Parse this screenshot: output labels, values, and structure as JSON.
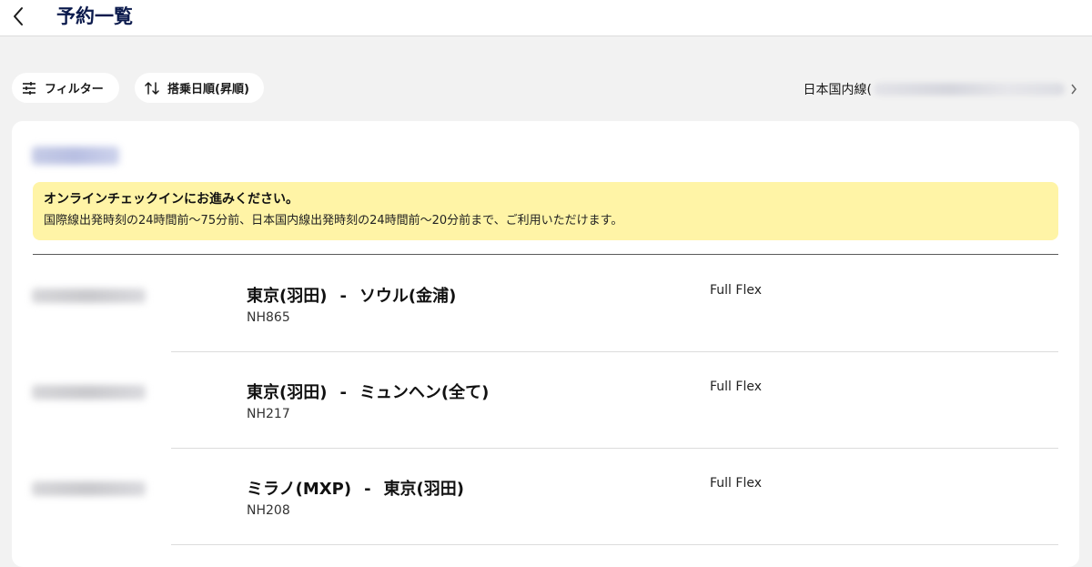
{
  "header": {
    "back_icon": "chevron-left-icon",
    "title": "予約一覧"
  },
  "toolbar": {
    "filter_label": "フィルター",
    "filter_icon": "sliders-icon",
    "sort_label": "搭乗日順(昇順)",
    "sort_icon": "sort-arrows-icon",
    "domestic_link_label": "日本国内線("
  },
  "notice": {
    "title": "オンラインチェックインにお進みください。",
    "body": "国際線出発時刻の24時間前〜75分前、日本国内線出発時刻の24時間前〜20分前まで、ご利用いただけます。"
  },
  "bookings": [
    {
      "origin": "東京(羽田)",
      "separator": "-",
      "destination": "ソウル(金浦)",
      "flight_no": "NH865",
      "fare": "Full Flex"
    },
    {
      "origin": "東京(羽田)",
      "separator": "-",
      "destination": "ミュンヘン(全て)",
      "flight_no": "NH217",
      "fare": "Full Flex"
    },
    {
      "origin": "ミラノ(MXP)",
      "separator": "-",
      "destination": "東京(羽田)",
      "flight_no": "NH208",
      "fare": "Full Flex"
    }
  ],
  "colors": {
    "title": "#0c1b4d",
    "notice_bg": "#fff4a6",
    "page_bg": "#f2f2f2"
  }
}
